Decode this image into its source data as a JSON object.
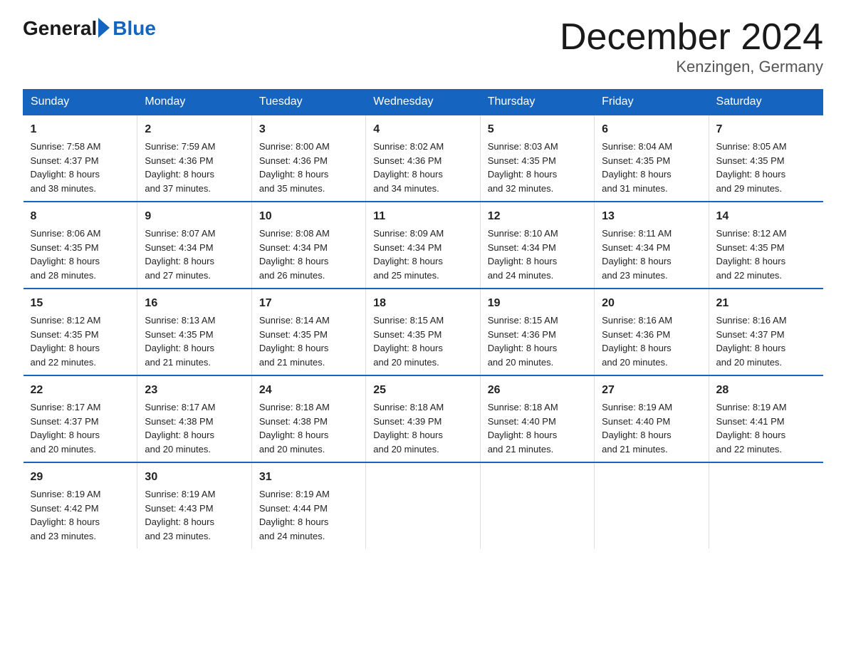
{
  "logo": {
    "general": "General",
    "blue": "Blue"
  },
  "title": "December 2024",
  "subtitle": "Kenzingen, Germany",
  "calendar": {
    "headers": [
      "Sunday",
      "Monday",
      "Tuesday",
      "Wednesday",
      "Thursday",
      "Friday",
      "Saturday"
    ],
    "weeks": [
      [
        {
          "day": "1",
          "sunrise": "7:58 AM",
          "sunset": "4:37 PM",
          "daylight": "8 hours and 38 minutes."
        },
        {
          "day": "2",
          "sunrise": "7:59 AM",
          "sunset": "4:36 PM",
          "daylight": "8 hours and 37 minutes."
        },
        {
          "day": "3",
          "sunrise": "8:00 AM",
          "sunset": "4:36 PM",
          "daylight": "8 hours and 35 minutes."
        },
        {
          "day": "4",
          "sunrise": "8:02 AM",
          "sunset": "4:36 PM",
          "daylight": "8 hours and 34 minutes."
        },
        {
          "day": "5",
          "sunrise": "8:03 AM",
          "sunset": "4:35 PM",
          "daylight": "8 hours and 32 minutes."
        },
        {
          "day": "6",
          "sunrise": "8:04 AM",
          "sunset": "4:35 PM",
          "daylight": "8 hours and 31 minutes."
        },
        {
          "day": "7",
          "sunrise": "8:05 AM",
          "sunset": "4:35 PM",
          "daylight": "8 hours and 29 minutes."
        }
      ],
      [
        {
          "day": "8",
          "sunrise": "8:06 AM",
          "sunset": "4:35 PM",
          "daylight": "8 hours and 28 minutes."
        },
        {
          "day": "9",
          "sunrise": "8:07 AM",
          "sunset": "4:34 PM",
          "daylight": "8 hours and 27 minutes."
        },
        {
          "day": "10",
          "sunrise": "8:08 AM",
          "sunset": "4:34 PM",
          "daylight": "8 hours and 26 minutes."
        },
        {
          "day": "11",
          "sunrise": "8:09 AM",
          "sunset": "4:34 PM",
          "daylight": "8 hours and 25 minutes."
        },
        {
          "day": "12",
          "sunrise": "8:10 AM",
          "sunset": "4:34 PM",
          "daylight": "8 hours and 24 minutes."
        },
        {
          "day": "13",
          "sunrise": "8:11 AM",
          "sunset": "4:34 PM",
          "daylight": "8 hours and 23 minutes."
        },
        {
          "day": "14",
          "sunrise": "8:12 AM",
          "sunset": "4:35 PM",
          "daylight": "8 hours and 22 minutes."
        }
      ],
      [
        {
          "day": "15",
          "sunrise": "8:12 AM",
          "sunset": "4:35 PM",
          "daylight": "8 hours and 22 minutes."
        },
        {
          "day": "16",
          "sunrise": "8:13 AM",
          "sunset": "4:35 PM",
          "daylight": "8 hours and 21 minutes."
        },
        {
          "day": "17",
          "sunrise": "8:14 AM",
          "sunset": "4:35 PM",
          "daylight": "8 hours and 21 minutes."
        },
        {
          "day": "18",
          "sunrise": "8:15 AM",
          "sunset": "4:35 PM",
          "daylight": "8 hours and 20 minutes."
        },
        {
          "day": "19",
          "sunrise": "8:15 AM",
          "sunset": "4:36 PM",
          "daylight": "8 hours and 20 minutes."
        },
        {
          "day": "20",
          "sunrise": "8:16 AM",
          "sunset": "4:36 PM",
          "daylight": "8 hours and 20 minutes."
        },
        {
          "day": "21",
          "sunrise": "8:16 AM",
          "sunset": "4:37 PM",
          "daylight": "8 hours and 20 minutes."
        }
      ],
      [
        {
          "day": "22",
          "sunrise": "8:17 AM",
          "sunset": "4:37 PM",
          "daylight": "8 hours and 20 minutes."
        },
        {
          "day": "23",
          "sunrise": "8:17 AM",
          "sunset": "4:38 PM",
          "daylight": "8 hours and 20 minutes."
        },
        {
          "day": "24",
          "sunrise": "8:18 AM",
          "sunset": "4:38 PM",
          "daylight": "8 hours and 20 minutes."
        },
        {
          "day": "25",
          "sunrise": "8:18 AM",
          "sunset": "4:39 PM",
          "daylight": "8 hours and 20 minutes."
        },
        {
          "day": "26",
          "sunrise": "8:18 AM",
          "sunset": "4:40 PM",
          "daylight": "8 hours and 21 minutes."
        },
        {
          "day": "27",
          "sunrise": "8:19 AM",
          "sunset": "4:40 PM",
          "daylight": "8 hours and 21 minutes."
        },
        {
          "day": "28",
          "sunrise": "8:19 AM",
          "sunset": "4:41 PM",
          "daylight": "8 hours and 22 minutes."
        }
      ],
      [
        {
          "day": "29",
          "sunrise": "8:19 AM",
          "sunset": "4:42 PM",
          "daylight": "8 hours and 23 minutes."
        },
        {
          "day": "30",
          "sunrise": "8:19 AM",
          "sunset": "4:43 PM",
          "daylight": "8 hours and 23 minutes."
        },
        {
          "day": "31",
          "sunrise": "8:19 AM",
          "sunset": "4:44 PM",
          "daylight": "8 hours and 24 minutes."
        },
        null,
        null,
        null,
        null
      ]
    ],
    "labels": {
      "sunrise": "Sunrise:",
      "sunset": "Sunset:",
      "daylight": "Daylight:"
    }
  }
}
